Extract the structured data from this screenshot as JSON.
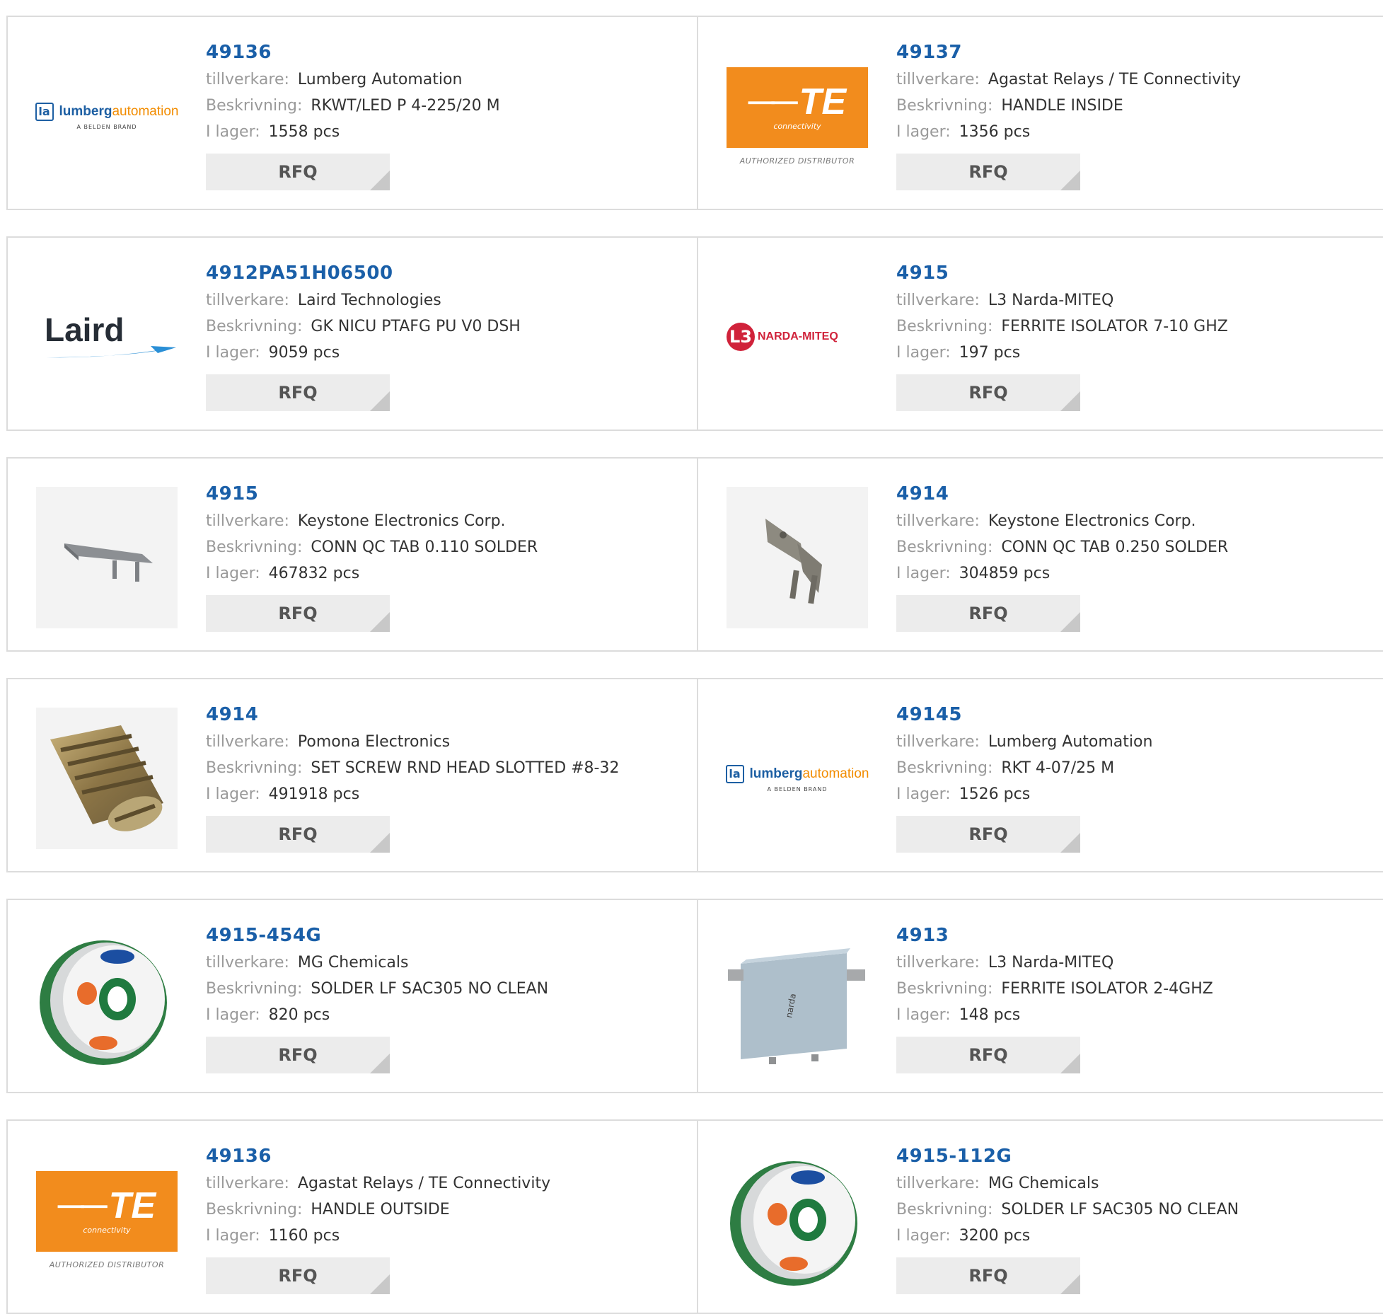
{
  "labels": {
    "manufacturer": "tillverkare:",
    "description": "Beskrivning:",
    "stock": "I lager:",
    "rfq": "RFQ"
  },
  "brand_colors": {
    "part_number": "#1a5fa8",
    "lumberg_blue": "#1d5fa3",
    "lumberg_orange": "#f28c00",
    "te_orange": "#f28c1d",
    "narda_red": "#d0223a"
  },
  "logo_text": {
    "lumberg_mark": "la",
    "lumberg_name_a": "lumberg",
    "lumberg_name_b": "automation",
    "lumberg_sub": "A BELDEN BRAND",
    "te_mark": "TE",
    "te_sub": "connectivity",
    "te_authorized": "AUTHORIZED DISTRIBUTOR",
    "laird": "Laird",
    "narda_mark": "L3",
    "narda_name": "NARDA-MITEQ"
  },
  "products": [
    {
      "part": "49136",
      "manufacturer": "Lumberg Automation",
      "description": "RKWT/LED P 4-225/20 M",
      "stock": "1558 pcs",
      "image": "lumberg-logo"
    },
    {
      "part": "49137",
      "manufacturer": "Agastat Relays / TE Connectivity",
      "description": "HANDLE INSIDE",
      "stock": "1356 pcs",
      "image": "te-logo"
    },
    {
      "part": "4912PA51H06500",
      "manufacturer": "Laird Technologies",
      "description": "GK NICU PTAFG PU V0 DSH",
      "stock": "9059 pcs",
      "image": "laird-logo"
    },
    {
      "part": "4915",
      "manufacturer": "L3 Narda-MITEQ",
      "description": "FERRITE ISOLATOR 7-10 GHZ",
      "stock": "197 pcs",
      "image": "narda-logo"
    },
    {
      "part": "4915",
      "manufacturer": "Keystone Electronics Corp.",
      "description": "CONN QC TAB 0.110 SOLDER",
      "stock": "467832 pcs",
      "image": "qc-tab-flat-photo"
    },
    {
      "part": "4914",
      "manufacturer": "Keystone Electronics Corp.",
      "description": "CONN QC TAB 0.250 SOLDER",
      "stock": "304859 pcs",
      "image": "qc-tab-bent-photo"
    },
    {
      "part": "4914",
      "manufacturer": "Pomona Electronics",
      "description": "SET SCREW RND HEAD SLOTTED #8-32",
      "stock": "491918 pcs",
      "image": "set-screw-photo"
    },
    {
      "part": "49145",
      "manufacturer": "Lumberg Automation",
      "description": "RKT 4-07/25 M",
      "stock": "1526 pcs",
      "image": "lumberg-logo"
    },
    {
      "part": "4915-454G",
      "manufacturer": "MG Chemicals",
      "description": "SOLDER LF SAC305 NO CLEAN",
      "stock": "820 pcs",
      "image": "solder-spool-photo"
    },
    {
      "part": "4913",
      "manufacturer": "L3 Narda-MITEQ",
      "description": "FERRITE ISOLATOR 2-4GHZ",
      "stock": "148 pcs",
      "image": "isolator-photo"
    },
    {
      "part": "49136",
      "manufacturer": "Agastat Relays / TE Connectivity",
      "description": "HANDLE OUTSIDE",
      "stock": "1160 pcs",
      "image": "te-logo"
    },
    {
      "part": "4915-112G",
      "manufacturer": "MG Chemicals",
      "description": "SOLDER LF SAC305 NO CLEAN",
      "stock": "3200 pcs",
      "image": "solder-spool-photo"
    }
  ]
}
